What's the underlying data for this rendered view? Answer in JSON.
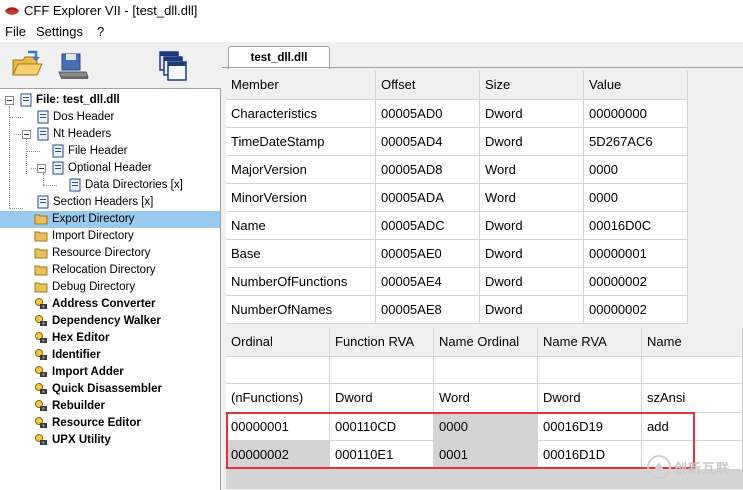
{
  "window": {
    "title": "CFF Explorer VII - [test_dll.dll]"
  },
  "menu": [
    "File",
    "Settings",
    "?"
  ],
  "toolbar": {
    "buttons": [
      "open-folder-icon",
      "save-disk-icon",
      "windows-icon"
    ]
  },
  "tab": {
    "label": "test_dll.dll"
  },
  "tree": {
    "items": [
      {
        "label": "File: test_dll.dll",
        "bold": true,
        "icon": "file-icon"
      },
      {
        "label": "Dos Header",
        "icon": "doc-icon"
      },
      {
        "label": "Nt Headers",
        "icon": "doc-icon"
      },
      {
        "label": "File Header",
        "icon": "doc-icon"
      },
      {
        "label": "Optional Header",
        "icon": "doc-icon"
      },
      {
        "label": "Data Directories [x]",
        "icon": "doc-icon"
      },
      {
        "label": "Section Headers [x]",
        "icon": "doc-icon"
      },
      {
        "label": "Export Directory",
        "icon": "folder-icon",
        "selected": true
      },
      {
        "label": "Import Directory",
        "icon": "folder-icon"
      },
      {
        "label": "Resource Directory",
        "icon": "folder-icon"
      },
      {
        "label": "Relocation Directory",
        "icon": "folder-icon"
      },
      {
        "label": "Debug Directory",
        "icon": "folder-icon"
      },
      {
        "label": "Address Converter",
        "bold": true,
        "icon": "tool-icon"
      },
      {
        "label": "Dependency Walker",
        "bold": true,
        "icon": "tool-icon"
      },
      {
        "label": "Hex Editor",
        "bold": true,
        "icon": "tool-icon"
      },
      {
        "label": "Identifier",
        "bold": true,
        "icon": "tool-icon"
      },
      {
        "label": "Import Adder",
        "bold": true,
        "icon": "tool-icon"
      },
      {
        "label": "Quick Disassembler",
        "bold": true,
        "icon": "tool-icon"
      },
      {
        "label": "Rebuilder",
        "bold": true,
        "icon": "tool-icon"
      },
      {
        "label": "Resource Editor",
        "bold": true,
        "icon": "tool-icon"
      },
      {
        "label": "UPX Utility",
        "bold": true,
        "icon": "tool-icon"
      }
    ]
  },
  "export_table": {
    "columns": [
      "Member",
      "Offset",
      "Size",
      "Value"
    ],
    "rows": [
      [
        "Characteristics",
        "00005AD0",
        "Dword",
        "00000000"
      ],
      [
        "TimeDateStamp",
        "00005AD4",
        "Dword",
        "5D267AC6"
      ],
      [
        "MajorVersion",
        "00005AD8",
        "Word",
        "0000"
      ],
      [
        "MinorVersion",
        "00005ADA",
        "Word",
        "0000"
      ],
      [
        "Name",
        "00005ADC",
        "Dword",
        "00016D0C"
      ],
      [
        "Base",
        "00005AE0",
        "Dword",
        "00000001"
      ],
      [
        "NumberOfFunctions",
        "00005AE4",
        "Dword",
        "00000002"
      ],
      [
        "NumberOfNames",
        "00005AE8",
        "Dword",
        "00000002"
      ]
    ]
  },
  "functions_table": {
    "columns": [
      "Ordinal",
      "Function RVA",
      "Name Ordinal",
      "Name RVA",
      "Name"
    ],
    "type_row": [
      "(nFunctions)",
      "Dword",
      "Word",
      "Dword",
      "szAnsi"
    ],
    "rows": [
      [
        "00000001",
        "000110CD",
        "0000",
        "00016D19",
        "add"
      ],
      [
        "00000002",
        "000110E1",
        "0001",
        "00016D1D",
        ""
      ]
    ]
  },
  "watermark": {
    "text": "创新互联"
  },
  "colors": {
    "selection": "#99c9ef",
    "highlight_box": "#e53238",
    "grid_line": "#d4d4d4"
  }
}
